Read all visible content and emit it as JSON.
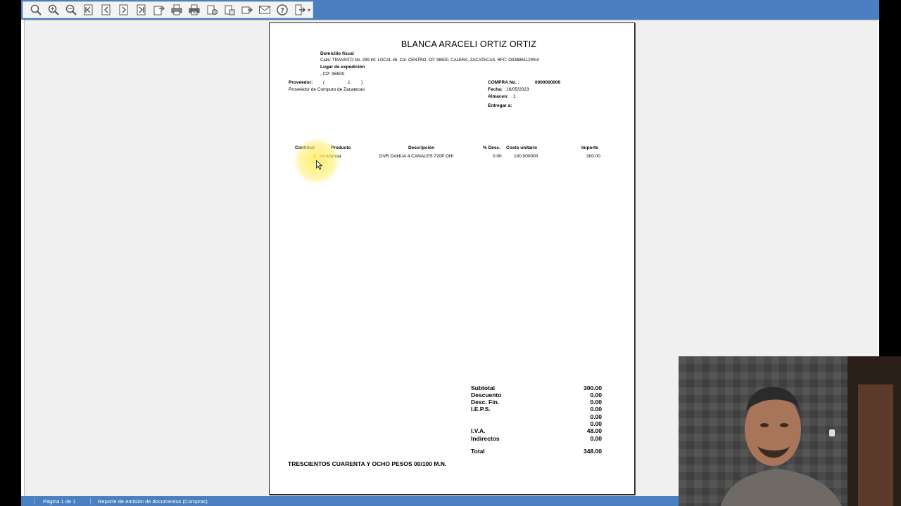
{
  "toolbar": {
    "icons": [
      "zoom-page-icon",
      "zoom-in-icon",
      "zoom-out-icon",
      "first-page-icon",
      "previous-page-icon",
      "next-page-icon",
      "last-page-icon",
      "export-icon",
      "print-icon",
      "print-setup-icon",
      "send-icon",
      "save-icon",
      "email-export-icon",
      "mail-icon",
      "help-icon",
      "exit-icon"
    ]
  },
  "document": {
    "company_name": "BLANCA ARACELI ORTIZ ORTIZ",
    "fiscal_label": "Domicilio fiscal",
    "fiscal_address": "Calle: TRANSITO No. 299 Int: LOCAL 46, Col. CENTRO, CP: 98500, CALERA, ZACATECAS. RFC: OIOB861129SI4",
    "issue_label": "Lugar de expedición",
    "issue_value": ", CP: 98500",
    "supplier_label": "Proveedor:",
    "supplier_open": "(",
    "supplier_id": "1",
    "supplier_close": ")",
    "supplier_name": "Proveedor de Computo de Zacatecas",
    "purchase_label": "COMPRA No. :",
    "purchase_no": "0000000006",
    "date_label": "Fecha:",
    "date_value": "16/05/2023",
    "warehouse_label": "Almacen:",
    "warehouse_value": "1",
    "deliver_label": "Entregar a:",
    "columns": {
      "qty": "Cantidad",
      "product": "Producto",
      "description": "Descripción",
      "discount": "% Desc.",
      "unit_cost": "Costo unitario",
      "amount": "Importe"
    },
    "rows": [
      {
        "qty": "3",
        "product": "xvr4dahua",
        "description": "DVR DAHUA 4 CANALES 720P DHI",
        "discount": "0.00",
        "unit_cost": "100.000000",
        "amount": "300.00"
      }
    ],
    "totals": {
      "subtotal_label": "Subtotal",
      "subtotal": "300.00",
      "discount_label": "Descuento",
      "discount": "0.00",
      "fin_label": "Desc. Fin.",
      "fin": "0.00",
      "ieps_label": "I.E.P.S.",
      "ieps": "0.00",
      "extra1": "0.00",
      "extra2": "0.00",
      "iva_label": "I.V.A.",
      "iva": "48.00",
      "indirect_label": "Indirectos",
      "indirect": "0.00",
      "total_label": "Total",
      "total": "348.00"
    },
    "amount_words": "TRESCIENTOS CUARENTA Y OCHO PESOS 00/100 M.N."
  },
  "status": {
    "page": "Página 1 de 1",
    "report": "Reporte de emisión de documentos (Compras)"
  },
  "colors": {
    "toolbar": "#4a7fc1",
    "workspace": "#f0f0f0",
    "highlight": "#ffec5a"
  }
}
